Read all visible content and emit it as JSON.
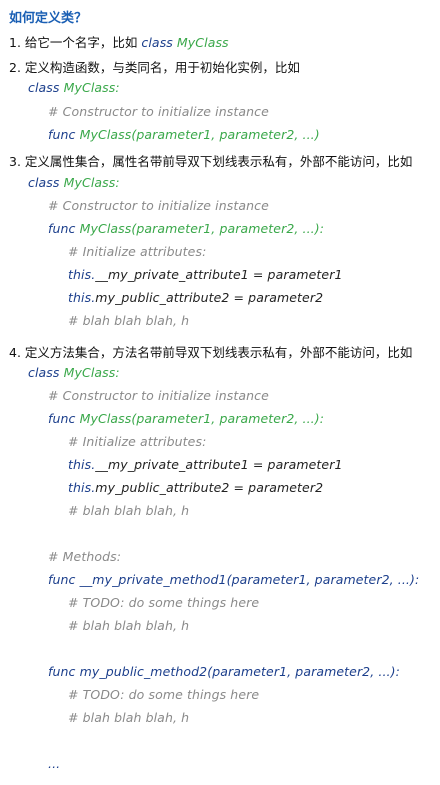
{
  "title": "如何定义类？",
  "steps": {
    "s1": {
      "text": "1. 给它一个名字，比如",
      "kw": "class",
      "cls": "MyClass"
    },
    "s2": {
      "text": "2. 定义构造函数，与类同名，用于初始化实例，比如"
    },
    "s3": {
      "text": "3. 定义属性集合，属性名带前导双下划线表示私有，外部不能访问，比如"
    },
    "s4": {
      "text": "4. 定义方法集合，方法名带前导双下划线表示私有，外部不能访问，比如"
    }
  },
  "code": {
    "kw_class": "class",
    "kw_func": "func",
    "class_name": "MyClass:",
    "ctor_comment": "# Constructor to initialize instance",
    "ctor_sig_a": "MyClass(parameter1, parameter2, ...)",
    "ctor_sig_b": "MyClass(parameter1, parameter2, ...):",
    "init_comment": "# Initialize attributes:",
    "this_kw": "this.",
    "private_attr": "__my_private_attribute1 = parameter1",
    "public_attr": "my_public_attribute2 = parameter2",
    "blah": "# blah blah blah, h",
    "methods_comment": "# Methods:",
    "private_method": "__my_private_method1(parameter1, parameter2, ...):",
    "todo": "# TODO: do some things here",
    "public_method": "my_public_method2(parameter1, parameter2, ...):",
    "ellipsis": "..."
  }
}
